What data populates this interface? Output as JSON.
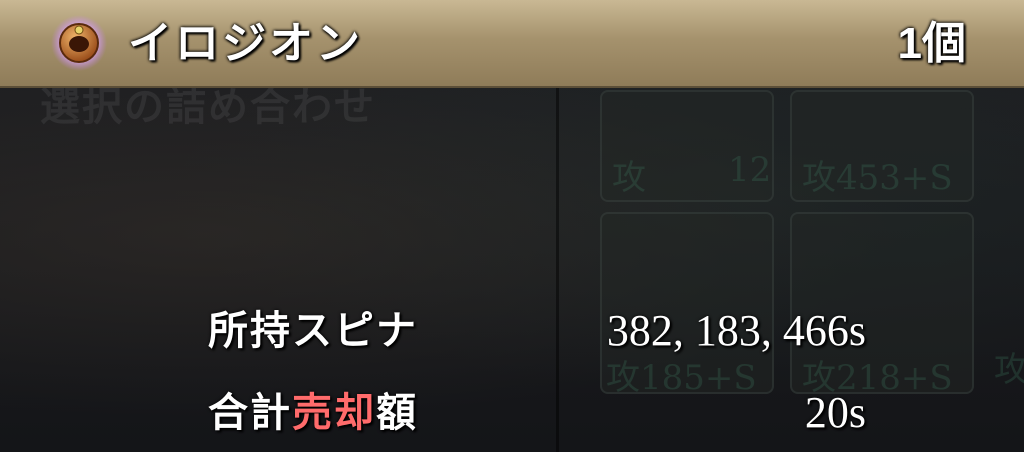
{
  "header": {
    "item_name": "イロジオン",
    "item_count": "1個",
    "icon": "ring-icon"
  },
  "background": {
    "ghost_title": "選択の詰め合わせ",
    "ghost_stats": [
      "攻",
      "12",
      "攻453+S",
      "攻185+S",
      "攻218+S",
      "攻"
    ]
  },
  "summary": {
    "owned_label": "所持スピナ",
    "owned_value": "382, 183, 466s",
    "sale_label_prefix": "合計",
    "sale_label_accent": "売却",
    "sale_label_suffix": "額",
    "sale_value": "20s"
  },
  "colors": {
    "header": "#a5926d",
    "accent": "#ff6b6b",
    "background": "#16171a",
    "icon_glow": "#c77dff"
  }
}
